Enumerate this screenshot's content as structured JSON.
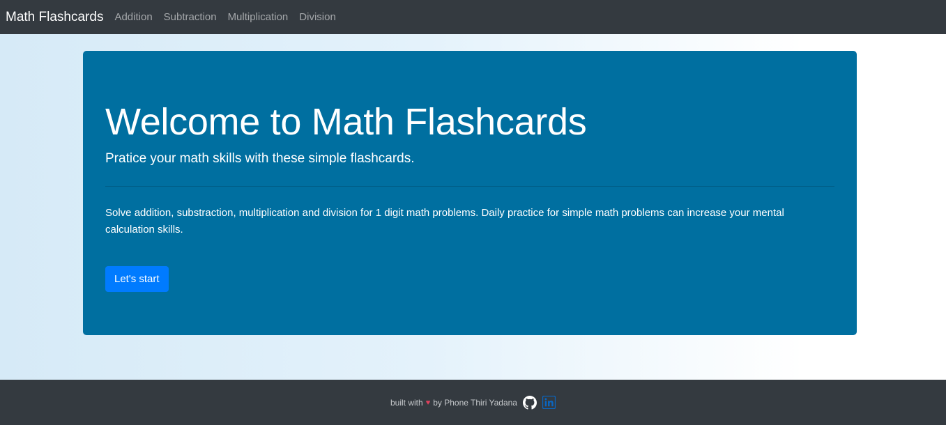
{
  "navbar": {
    "brand": "Math Flashcards",
    "links": [
      {
        "label": "Addition"
      },
      {
        "label": "Subtraction"
      },
      {
        "label": "Multiplication"
      },
      {
        "label": "Division"
      }
    ]
  },
  "jumbotron": {
    "title": "Welcome to Math Flashcards",
    "lead": "Pratice your math skills with these simple flashcards.",
    "description": "Solve addition, substraction, multiplication and division for 1 digit math problems. Daily practice for simple math problems can increase your mental calculation skills.",
    "button_label": "Let's start"
  },
  "footer": {
    "built_with": "built with",
    "heart": "♥",
    "by_text": "by Phone Thiri Yadana",
    "icons": [
      "github-icon",
      "linkedin-icon"
    ]
  },
  "colors": {
    "navbar_bg": "#343a40",
    "jumbotron_bg": "#006fa0",
    "button_bg": "#007bff",
    "heart": "#e0405c",
    "linkedin": "#0a66c2"
  }
}
